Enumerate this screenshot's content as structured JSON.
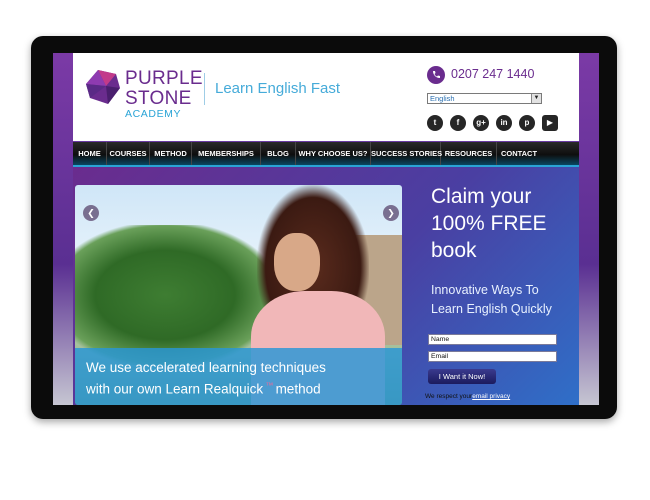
{
  "header": {
    "logo_line1": "PURPLE",
    "logo_line2": "STONE",
    "logo_line3": "ACADEMY",
    "tagline": "Learn English Fast",
    "phone": "0207 247 1440",
    "language_selected": "English"
  },
  "social_icons": [
    "twitter-icon",
    "facebook-icon",
    "google-plus-icon",
    "linkedin-icon",
    "pinterest-icon",
    "youtube-icon"
  ],
  "nav": {
    "items": [
      "HOME",
      "COURSES",
      "METHOD",
      "MEMBERSHIPS",
      "BLOG",
      "WHY CHOOSE US?",
      "SUCCESS STORIES",
      "RESOURCES",
      "CONTACT"
    ]
  },
  "slider": {
    "caption_line1": "We use accelerated learning techniques",
    "caption_line2": "with our own Learn Realquick",
    "caption_line2_end": "method"
  },
  "offer": {
    "line1": "Claim your",
    "line2": "100% FREE",
    "line3": "book",
    "sub_line1": "Innovative Ways To",
    "sub_line2": "Learn English Quickly",
    "name_placeholder": "Name",
    "email_placeholder": "Email",
    "submit_label": "I Want it Now!",
    "privacy_text": "We respect your",
    "privacy_link": "email privacy"
  },
  "colors": {
    "brand_purple": "#6a2c8e",
    "accent_blue": "#2aa4d6"
  }
}
